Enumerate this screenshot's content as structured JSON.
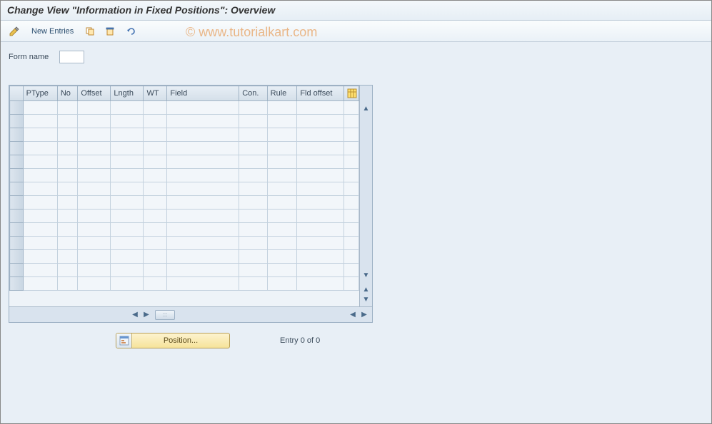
{
  "title": "Change View \"Information in Fixed Positions\": Overview",
  "watermark": "© www.tutorialkart.com",
  "toolbar": {
    "new_entries_label": "New Entries"
  },
  "form": {
    "name_label": "Form name",
    "name_value": ""
  },
  "grid": {
    "columns": [
      "PType",
      "No",
      "Offset",
      "Lngth",
      "WT",
      "Field",
      "Con.",
      "Rule",
      "Fld offset"
    ],
    "row_count": 14
  },
  "footer": {
    "position_label": "Position...",
    "entry_text": "Entry 0 of 0"
  }
}
